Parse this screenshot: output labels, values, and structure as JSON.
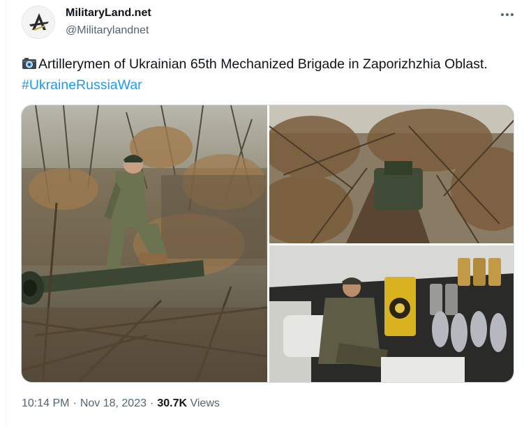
{
  "author": {
    "display_name": "MilitaryLand.net",
    "handle": "@Militarylandnet",
    "avatar_icon": "militaryland-logo-icon"
  },
  "tweet": {
    "text_main": "Artillerymen of Ukrainian 65th Mechanized Brigade in Zaporizhzhia Oblast.",
    "hashtag": "#UkraineRussiaWar",
    "leading_icon": "camera-emoji-icon"
  },
  "media": [
    {
      "alt_name": "soldier-on-howitzer-photo"
    },
    {
      "alt_name": "camouflaged-artillery-photo"
    },
    {
      "alt_name": "artillery-interior-photo"
    }
  ],
  "meta": {
    "time": "10:14 PM",
    "separator": "·",
    "date": "Nov 18, 2023",
    "views_count": "30.7K",
    "views_label": "Views"
  },
  "colors": {
    "accent": "#1d9bf0",
    "secondary_text": "#536471",
    "primary_text": "#0f1419"
  }
}
